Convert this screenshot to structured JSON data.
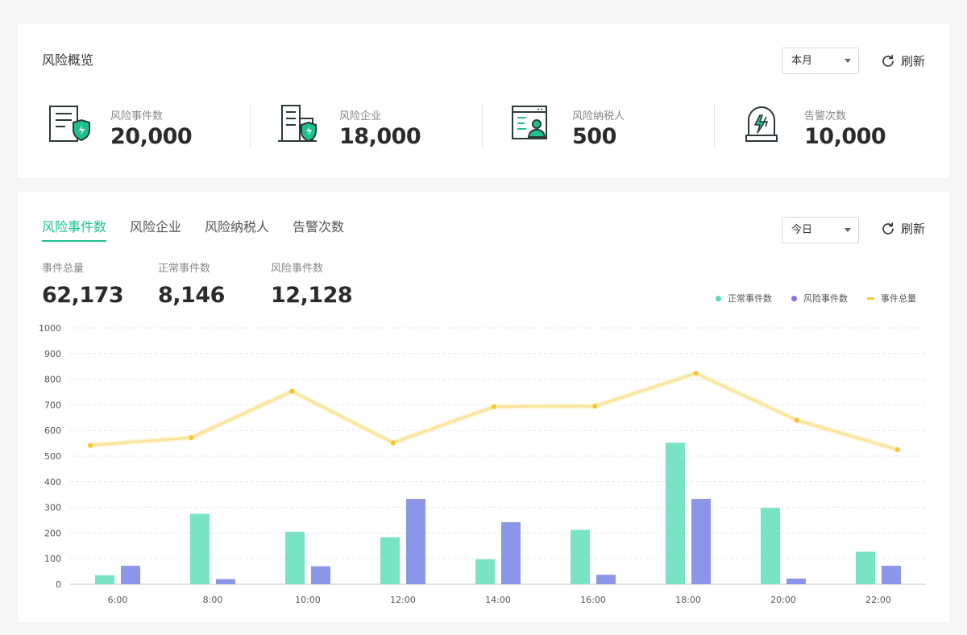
{
  "overview": {
    "title": "风险概览",
    "period": "本月",
    "refresh_label": "刷新",
    "stats": [
      {
        "label": "风险事件数",
        "value": "20,000",
        "icon": "document-shield-icon"
      },
      {
        "label": "风险企业",
        "value": "18,000",
        "icon": "building-shield-icon"
      },
      {
        "label": "风险纳税人",
        "value": "500",
        "icon": "browser-user-icon"
      },
      {
        "label": "告警次数",
        "value": "10,000",
        "icon": "alarm-lightning-icon"
      }
    ]
  },
  "detail": {
    "tabs": [
      "风险事件数",
      "风险企业",
      "风险纳税人",
      "告警次数"
    ],
    "active_tab": 0,
    "period": "今日",
    "refresh_label": "刷新",
    "summary": [
      {
        "label": "事件总量",
        "value": "62,173"
      },
      {
        "label": "正常事件数",
        "value": "8,146"
      },
      {
        "label": "风险事件数",
        "value": "12,128"
      }
    ]
  },
  "colors": {
    "accent": "#1fc08f",
    "normal_bar": "#7ae3c6",
    "risk_bar": "#8b96e8",
    "total_line": "#fbe49a",
    "total_point": "#f7c52c"
  },
  "chart_data": {
    "type": "bar",
    "categories": [
      "6:00",
      "8:00",
      "10:00",
      "12:00",
      "14:00",
      "16:00",
      "18:00",
      "20:00",
      "22:00"
    ],
    "ylim": [
      0,
      1000
    ],
    "yticks": [
      0,
      100,
      200,
      300,
      400,
      500,
      600,
      700,
      800,
      900,
      1000
    ],
    "legend_position": "top-right",
    "grid": true,
    "series": [
      {
        "name": "正常事件数",
        "type": "bar",
        "values": [
          35,
          275,
          205,
          183,
          97,
          212,
          552,
          298,
          127
        ]
      },
      {
        "name": "风险事件数",
        "type": "bar",
        "values": [
          72,
          20,
          70,
          333,
          242,
          37,
          333,
          22,
          72
        ]
      },
      {
        "name": "事件总量",
        "type": "line",
        "values": [
          542,
          572,
          753,
          552,
          693,
          695,
          823,
          640,
          525
        ]
      }
    ]
  }
}
